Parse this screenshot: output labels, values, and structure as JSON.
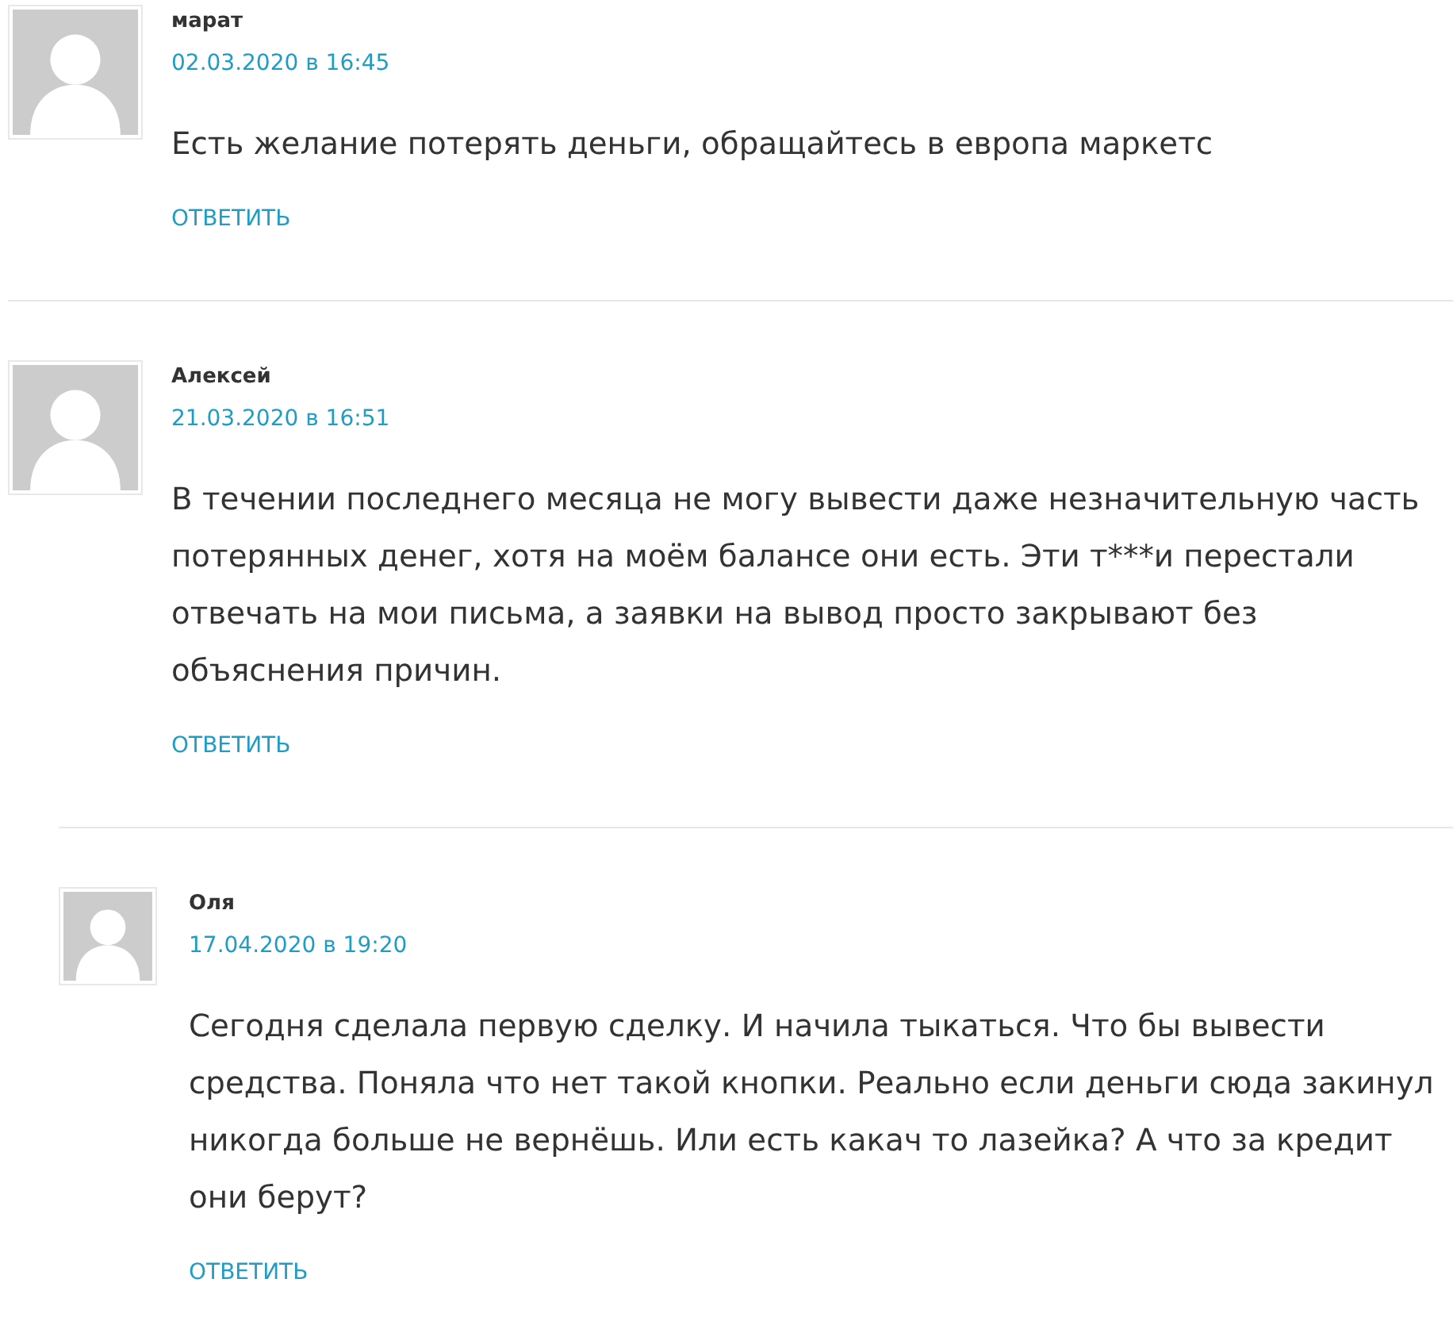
{
  "comments": [
    {
      "author": "марат",
      "date": "02.03.2020 в 16:45",
      "text": "Есть желание потерять деньги, обращайтесь в европа маркетс",
      "reply": "ОТВЕТИТЬ"
    },
    {
      "author": "Алексей",
      "date": "21.03.2020 в 16:51",
      "text": "В течении последнего месяца не могу вывести даже незначительную часть потерянных денег, хотя на моём балансе они есть. Эти т***и перестали отвечать на мои письма, а заявки на вывод просто закрывают без объяснения причин.",
      "reply": "ОТВЕТИТЬ",
      "children": [
        {
          "author": "Оля",
          "date": "17.04.2020 в 19:20",
          "text": "Сегодня сделала первую сделку. И начила тыкаться. Что бы вывести средства. Поняла что нет такой кнопки. Реально если деньги сюда закинул никогда больше не вернёшь. Или есть какач то лазейка? А что за кредит они берут?",
          "reply": "ОТВЕТИТЬ"
        }
      ]
    }
  ]
}
